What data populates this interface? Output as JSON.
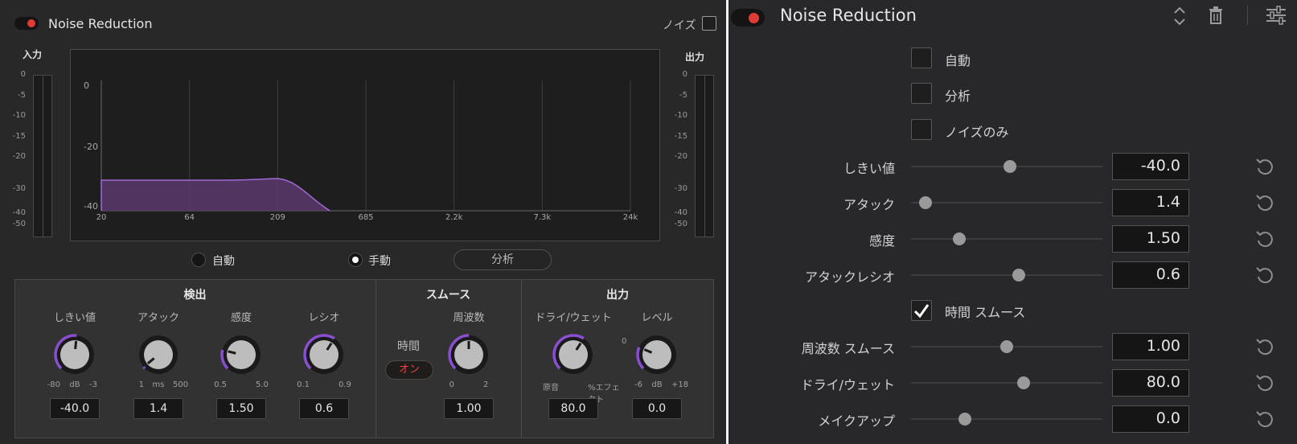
{
  "left": {
    "title": "Noise Reduction",
    "noise_label": "ノイズ",
    "input_label": "入力",
    "output_label": "出力",
    "meter_scale": [
      "0",
      "-5",
      "-10",
      "-15",
      "-20",
      "-30",
      "-40",
      "-50"
    ],
    "graph": {
      "y_labels": [
        "0",
        "-20",
        "-40"
      ],
      "x_labels": [
        "20",
        "64",
        "209",
        "685",
        "2.2k",
        "7.3k",
        "24k"
      ],
      "fill_color": "#5a3a6c",
      "line_color": "#a06ad4"
    },
    "mode": {
      "auto_label": "自動",
      "manual_label": "手動",
      "analyze_label": "分析",
      "selected": "manual"
    },
    "sections": {
      "detect": "検出",
      "smooth": "スムース",
      "output": "出力"
    },
    "knobs": [
      {
        "label": "しきい値",
        "min": "-80",
        "unit": "dB",
        "max": "-3",
        "value": "-40.0",
        "fraction": 0.52
      },
      {
        "label": "アタック",
        "min": "1",
        "unit": "ms",
        "max": "500",
        "value": "1.4",
        "fraction": 0.02
      },
      {
        "label": "感度",
        "min": "0.5",
        "unit": "",
        "max": "5.0",
        "value": "1.50",
        "fraction": 0.22
      },
      {
        "label": "レシオ",
        "min": "0.1",
        "unit": "",
        "max": "0.9",
        "value": "0.6",
        "fraction": 0.62
      },
      {
        "label": "周波数",
        "min": "0",
        "unit": "",
        "max": "2",
        "value": "1.00",
        "fraction": 0.5
      },
      {
        "label": "ドライ/ウェット",
        "min": "原音",
        "unit": "",
        "max": "%エフェクト",
        "value": "80.0",
        "fraction": 0.62
      },
      {
        "label": "レベル",
        "min": "-6",
        "unit": "dB",
        "max": "+18",
        "value": "0.0",
        "fraction": 0.25
      }
    ],
    "level_zero": "0",
    "time_label": "時間",
    "on_label": "オン",
    "accent": "#8a4fd0"
  },
  "right": {
    "title": "Noise Reduction",
    "checkboxes": [
      {
        "label": "自動",
        "checked": false
      },
      {
        "label": "分析",
        "checked": false
      },
      {
        "label": "ノイズのみ",
        "checked": false
      }
    ],
    "time_smooth": {
      "label": "時間 スムース",
      "checked": true
    },
    "sliders_a": [
      {
        "label": "しきい値",
        "value": "-40.0",
        "fraction": 0.52
      },
      {
        "label": "アタック",
        "value": "1.4",
        "fraction": 0.02
      },
      {
        "label": "感度",
        "value": "1.50",
        "fraction": 0.22
      },
      {
        "label": "アタックレシオ",
        "value": "0.6",
        "fraction": 0.57
      }
    ],
    "sliders_b": [
      {
        "label": "周波数 スムース",
        "value": "1.00",
        "fraction": 0.5
      },
      {
        "label": "ドライ/ウェット",
        "value": "80.0",
        "fraction": 0.6
      },
      {
        "label": "メイクアップ",
        "value": "0.0",
        "fraction": 0.25
      }
    ],
    "icons": [
      "chevron-updown-icon",
      "trash-icon",
      "sliders-icon",
      "reset-icon"
    ],
    "accent": "#e03b35"
  }
}
